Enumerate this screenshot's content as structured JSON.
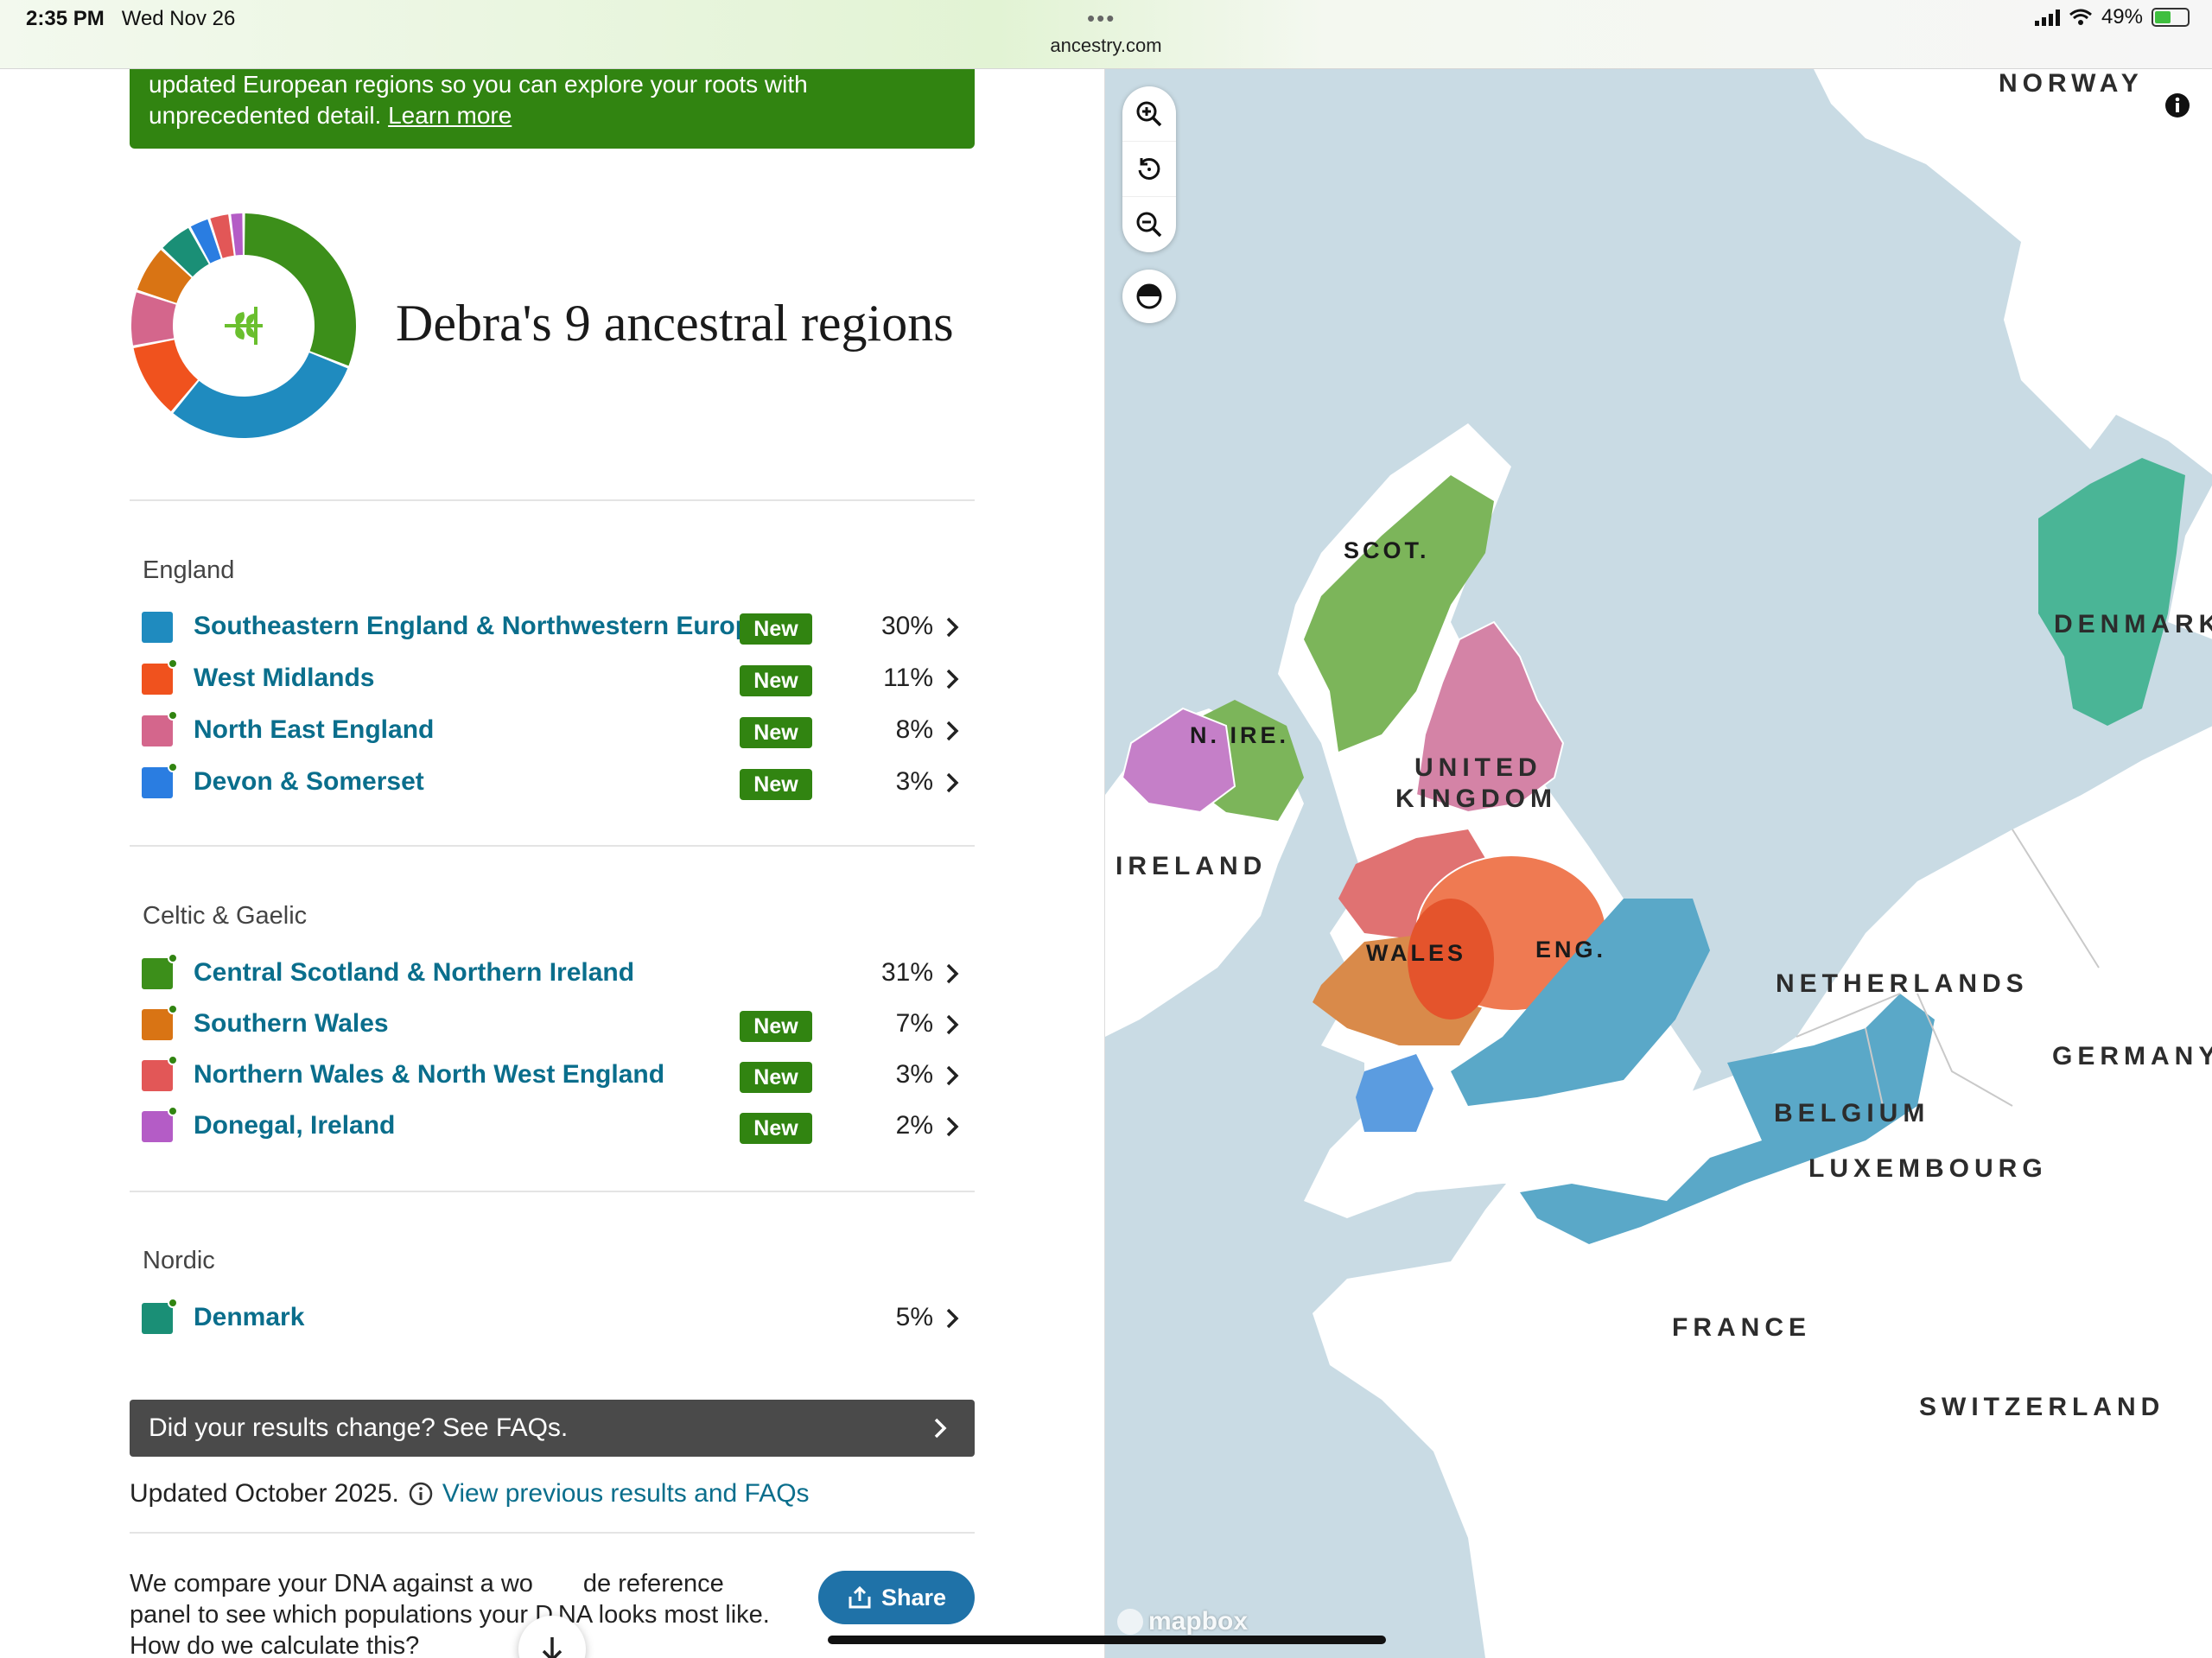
{
  "status_bar": {
    "time": "2:35 PM",
    "date": "Wed Nov 26",
    "url": "ancestry.com",
    "battery": "49%"
  },
  "banner": {
    "line1": "updated European regions so you can explore your roots with",
    "line2": "unprecedented detail.",
    "link": "Learn more"
  },
  "title": "Debra's 9 ancestral regions",
  "groups": [
    {
      "label": "England",
      "regions": [
        {
          "name": "Southeastern England & Northwestern Europe",
          "badge": "New",
          "percent": "30%",
          "color": "#1f8bbf",
          "dot": false
        },
        {
          "name": "West Midlands",
          "badge": "New",
          "percent": "11%",
          "color": "#f0521e",
          "dot": true
        },
        {
          "name": "North East England",
          "badge": "New",
          "percent": "8%",
          "color": "#d4668c",
          "dot": true
        },
        {
          "name": "Devon & Somerset",
          "badge": "New",
          "percent": "3%",
          "color": "#2a7de1",
          "dot": true
        }
      ]
    },
    {
      "label": "Celtic & Gaelic",
      "regions": [
        {
          "name": "Central Scotland & Northern Ireland",
          "badge": "",
          "percent": "31%",
          "color": "#3c8f1a",
          "dot": true
        },
        {
          "name": "Southern Wales",
          "badge": "New",
          "percent": "7%",
          "color": "#d97414",
          "dot": true
        },
        {
          "name": "Northern Wales & North West England",
          "badge": "New",
          "percent": "3%",
          "color": "#e25757",
          "dot": true
        },
        {
          "name": "Donegal, Ireland",
          "badge": "New",
          "percent": "2%",
          "color": "#b45cc6",
          "dot": true
        }
      ]
    },
    {
      "label": "Nordic",
      "regions": [
        {
          "name": "Denmark",
          "badge": "",
          "percent": "5%",
          "color": "#1a8f76",
          "dot": true
        }
      ]
    }
  ],
  "faq_bar": "Did your results change? See FAQs.",
  "updated": {
    "text": "Updated October 2025.",
    "link": "View previous results and FAQs"
  },
  "bottom": {
    "text": "We compare your DNA against a wo  de reference panel to see which populations your D NA looks most like. How do we calculate this?"
  },
  "share_label": "Share",
  "map": {
    "attribution": "mapbox",
    "labels": {
      "norway": "NORWAY",
      "denmark": "DENMARK",
      "scot": "SCOT.",
      "nire": "N. IRE.",
      "uk1": "UNITED",
      "uk2": "KINGDOM",
      "ireland": "IRELAND",
      "wales": "WALES",
      "eng": "ENG.",
      "netherlands": "NETHERLANDS",
      "germany": "GERMANY",
      "belgium": "BELGIUM",
      "luxembourg": "LUXEMBOURG",
      "france": "FRANCE",
      "switzerland": "SWITZERLAND"
    }
  },
  "donut": {
    "segments": [
      {
        "region": "Central Scotland & Northern Ireland",
        "value": 31,
        "color": "#3c8f1a"
      },
      {
        "region": "Southeastern England & Northwestern Europe",
        "value": 30,
        "color": "#1f8bbf"
      },
      {
        "region": "West Midlands",
        "value": 11,
        "color": "#f0521e"
      },
      {
        "region": "North East England",
        "value": 8,
        "color": "#d4668c"
      },
      {
        "region": "Southern Wales",
        "value": 7,
        "color": "#d97414"
      },
      {
        "region": "Denmark",
        "value": 5,
        "color": "#1a8f76"
      },
      {
        "region": "Devon & Somerset",
        "value": 3,
        "color": "#2a7de1"
      },
      {
        "region": "Northern Wales & North West England",
        "value": 3,
        "color": "#e25757"
      },
      {
        "region": "Donegal, Ireland",
        "value": 2,
        "color": "#b45cc6"
      }
    ]
  }
}
